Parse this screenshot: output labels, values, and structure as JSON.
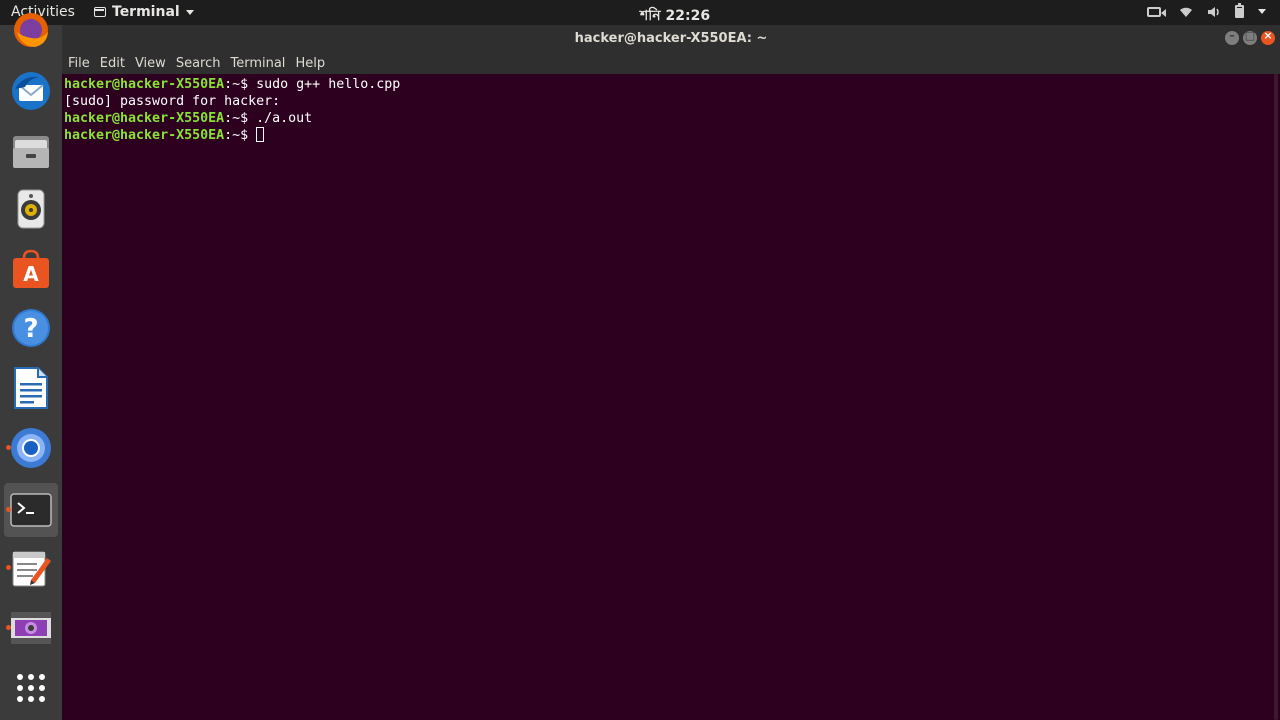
{
  "top_panel": {
    "activities": "Activities",
    "app_menu_label": "Terminal",
    "clock": "শনি 22:26"
  },
  "window": {
    "title": "hacker@hacker-X550EA: ~",
    "controls": [
      "minimize",
      "maximize",
      "close"
    ]
  },
  "menubar": {
    "items": [
      "File",
      "Edit",
      "View",
      "Search",
      "Terminal",
      "Help"
    ]
  },
  "terminal": {
    "prompt": "hacker@hacker-X550EA",
    "lines": [
      {
        "type": "prompt",
        "prompt": "hacker@hacker-X550EA",
        "suffix": ":~$ ",
        "command": "sudo g++ hello.cpp"
      },
      {
        "type": "output",
        "text": "[sudo] password for hacker:"
      },
      {
        "type": "prompt",
        "prompt": "hacker@hacker-X550EA",
        "suffix": ":~$ ",
        "command": "./a.out"
      },
      {
        "type": "prompt",
        "prompt": "hacker@hacker-X550EA",
        "suffix": ":~$ ",
        "command": ""
      }
    ]
  },
  "dock": {
    "items": [
      "firefox-icon",
      "thunderbird-icon",
      "files-icon",
      "rhythmbox-icon",
      "software-center-icon",
      "help-icon",
      "libreoffice-writer-icon",
      "chromium-icon",
      "terminal-icon",
      "text-editor-icon",
      "video-editor-icon",
      "show-applications-icon"
    ]
  },
  "colors": {
    "terminal_bg": "#2c001e",
    "prompt_green": "#8ae234",
    "accent_orange": "#e95420"
  }
}
